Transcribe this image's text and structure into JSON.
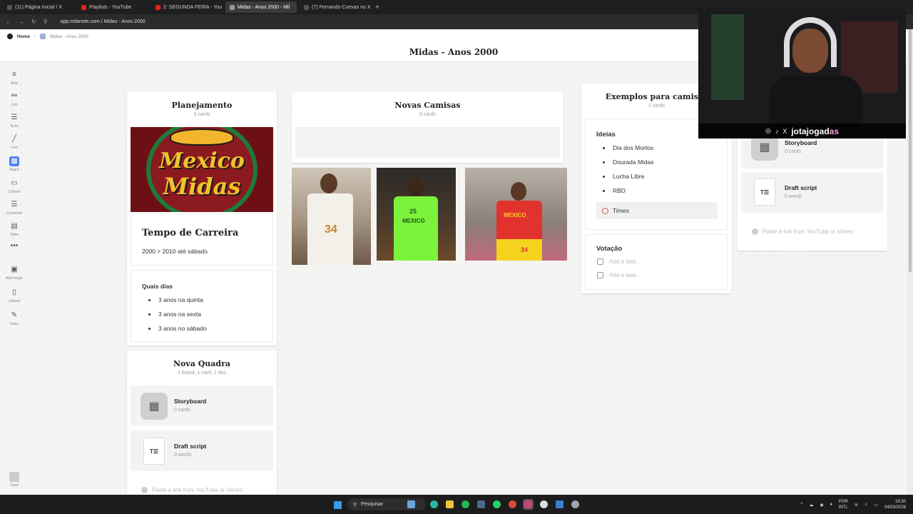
{
  "browser": {
    "tabs": [
      {
        "label": "(11) Página Inicial / X",
        "color": "#555"
      },
      {
        "label": "Playlists - YouTube",
        "color": "#e62117"
      },
      {
        "label": "2: SEGUNDA FEIRA - You",
        "color": "#e62117"
      },
      {
        "label": "Midas - Anos 2000 - Mil",
        "color": "#777",
        "active": true
      },
      {
        "label": "(7) Fernando Cuevas no X",
        "color": "#555"
      }
    ],
    "new_tab": "+",
    "url": "app.milanote.com / Midas - Anos 2000"
  },
  "app": {
    "breadcrumb": {
      "home": "Home",
      "current": "Midas - Anos 2000"
    },
    "title": "Midas - Anos 2000",
    "toolbar": [
      "Note",
      "Link",
      "To-do",
      "Line",
      "Board",
      "Column",
      "Comment",
      "Table",
      "",
      "Add image",
      "Upload",
      "Draw"
    ],
    "trash": "Trash"
  },
  "planejamento": {
    "title": "Planejamento",
    "count": "3 cards",
    "logo_line1": "Mexico",
    "logo_line2": "Midas",
    "career_title": "Tempo de Carreira",
    "career_text": "2000 > 2010 até sábado",
    "days_title": "Quais dias",
    "days": [
      "3 anos na quinta",
      "3 anos na sexta",
      "3 anos no sábado"
    ]
  },
  "nova_quadra": {
    "title": "Nova Quadra",
    "count": "1 board, 1 card, 1 doc",
    "storyboard": "Storyboard",
    "storyboard_sub": "0 cards",
    "draft": "Draft script",
    "draft_sub": "0 words",
    "link_placeholder": "Paste a link from YouTube or Vimeo"
  },
  "novas_camisas": {
    "title": "Novas Camisas",
    "count": "0 cards",
    "jersey_numbers": [
      "34",
      "25",
      "34"
    ],
    "jersey_text": "MEXICO"
  },
  "exemplos": {
    "title": "Exemplos para camisas",
    "count": "2 cards",
    "ideias_title": "Ideias",
    "ideias": [
      "Dia dos Mortos",
      "Dourada Midas",
      "Lucha Libre",
      "RBD"
    ],
    "times_label": "Times",
    "votacao_title": "Votação",
    "task_placeholders": [
      "Add a task...",
      "Add a task..."
    ]
  },
  "right_column": {
    "storyboard": "Storyboard",
    "storyboard_sub": "0 cards",
    "draft": "Draft script",
    "draft_sub": "0 words",
    "link_placeholder": "Paste a link from YouTube or Vimeo"
  },
  "webcam": {
    "handle_a": "jotajogad",
    "handle_b": "as",
    "icons": [
      "◎",
      "♪",
      "X"
    ]
  },
  "taskbar": {
    "search": "Pesquisar",
    "lang1": "POR",
    "lang2": "INTL",
    "time": "19:30",
    "date": "04/03/2026"
  }
}
